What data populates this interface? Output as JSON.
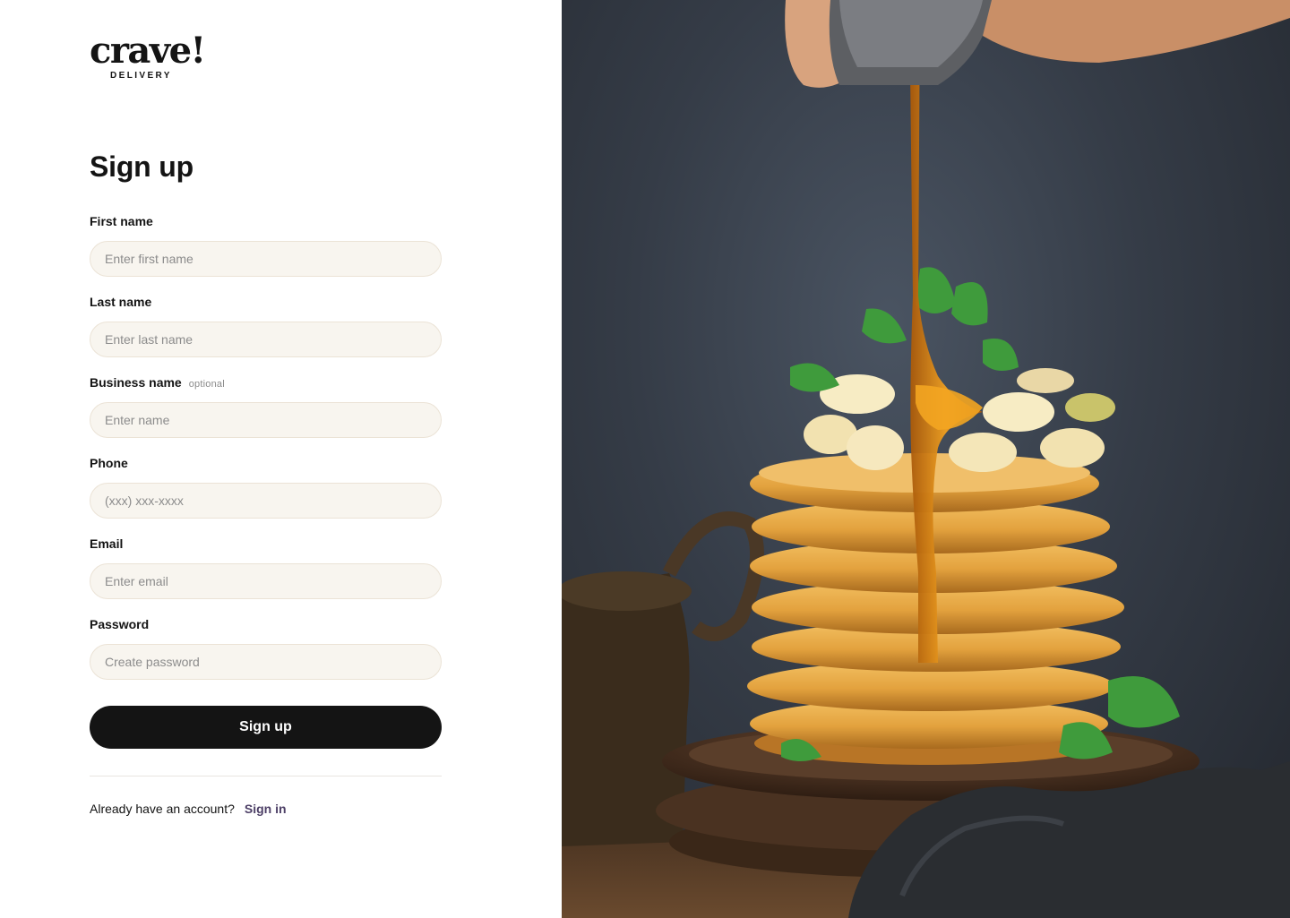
{
  "brand": {
    "name": "crave!",
    "tagline": "DELIVERY"
  },
  "form": {
    "title": "Sign up",
    "fields": [
      {
        "label": "First name",
        "optional_text": "",
        "placeholder": "Enter first name"
      },
      {
        "label": "Last name",
        "optional_text": "",
        "placeholder": "Enter last name"
      },
      {
        "label": "Business name",
        "optional_text": "optional",
        "placeholder": "Enter name"
      },
      {
        "label": "Phone",
        "optional_text": "",
        "placeholder": "(xxx) xxx-xxxx"
      },
      {
        "label": "Email",
        "optional_text": "",
        "placeholder": "Enter email"
      },
      {
        "label": "Password",
        "optional_text": "",
        "placeholder": "Create password"
      }
    ],
    "submit_label": "Sign up"
  },
  "footer": {
    "prompt": "Already have an account?",
    "signin_label": "Sign in"
  },
  "colors": {
    "primary": "#141414",
    "input_bg": "#f8f5ef",
    "link": "#4d3f66"
  },
  "hero_image": {
    "subject": "stack-of-pancakes-with-syrup"
  }
}
